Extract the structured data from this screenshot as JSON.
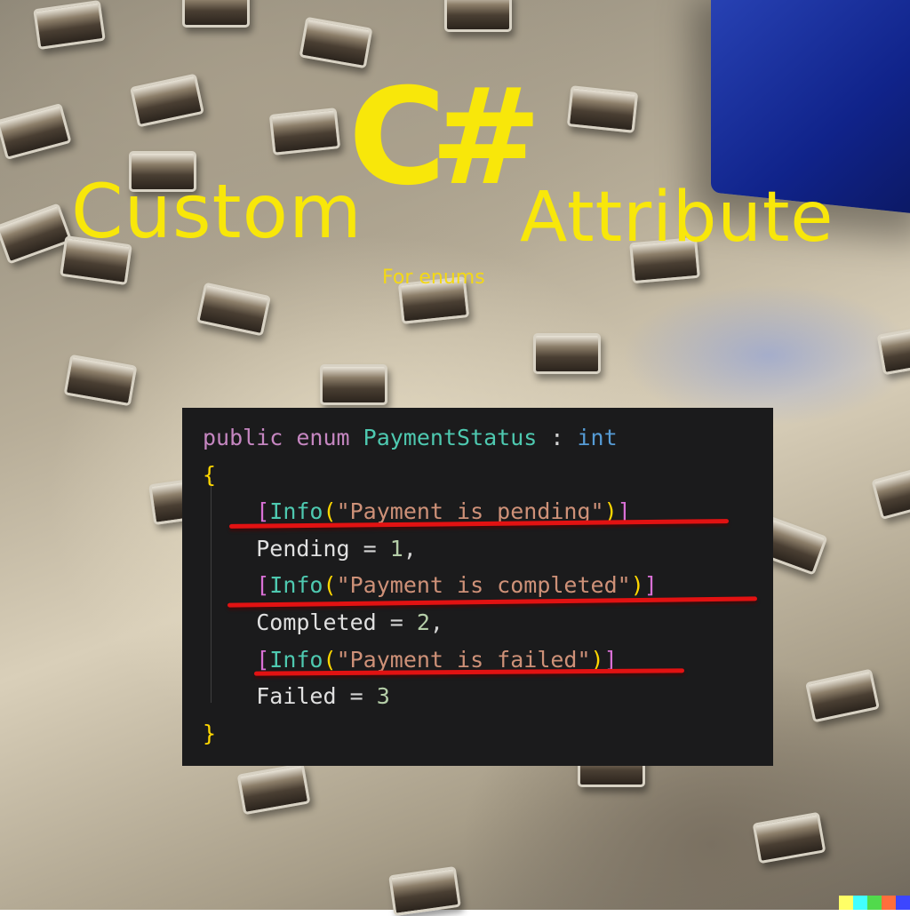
{
  "title": {
    "csharp": "C#",
    "left_word": "Custom",
    "right_word": "Attribute",
    "subtitle": "For enums"
  },
  "code": {
    "line1": {
      "kw1": "public",
      "kw2": "enum",
      "name": "PaymentStatus",
      "colon": " : ",
      "type": "int"
    },
    "open_brace": "{",
    "attr1": {
      "open": "[",
      "name": "Info",
      "paren_open": "(",
      "text": "\"Payment is pending\"",
      "paren_close": ")",
      "close": "]"
    },
    "member1": {
      "name": "Pending",
      "eq": " = ",
      "value": "1",
      "tail": ","
    },
    "attr2": {
      "open": "[",
      "name": "Info",
      "paren_open": "(",
      "text": "\"Payment is completed\"",
      "paren_close": ")",
      "close": "]"
    },
    "member2": {
      "name": "Completed",
      "eq": " = ",
      "value": "2",
      "tail": ","
    },
    "attr3": {
      "open": "[",
      "name": "Info",
      "paren_open": "(",
      "text": "\"Payment is failed\"",
      "paren_close": ")",
      "close": "]"
    },
    "member3": {
      "name": "Failed",
      "eq": " = ",
      "value": "3",
      "tail": ""
    },
    "close_brace": "}"
  },
  "colors": {
    "title_yellow": "#f8e70a",
    "underline_red": "#e21212",
    "code_bg": "#1b1b1c"
  }
}
